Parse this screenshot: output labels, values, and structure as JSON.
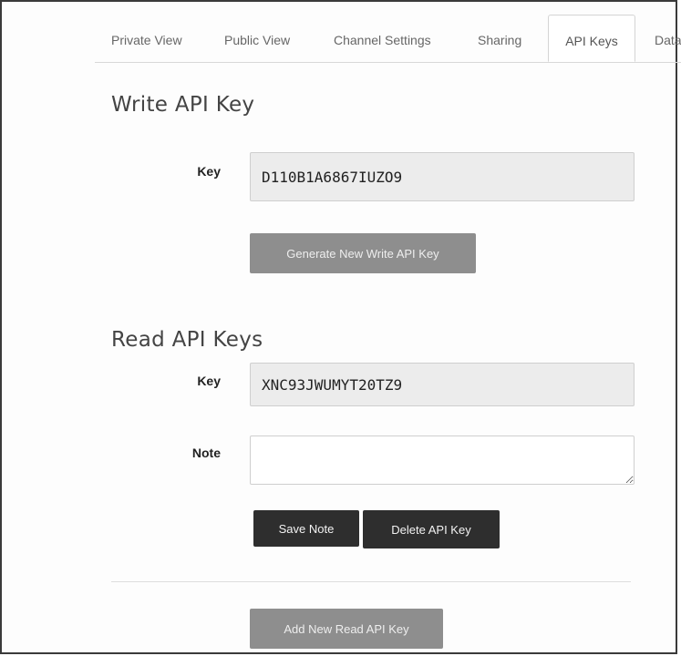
{
  "tabs": [
    {
      "label": "Private View",
      "active": false
    },
    {
      "label": "Public View",
      "active": false
    },
    {
      "label": "Channel Settings",
      "active": false
    },
    {
      "label": "Sharing",
      "active": false
    },
    {
      "label": "API Keys",
      "active": true
    },
    {
      "label": "Data",
      "active": false
    }
  ],
  "write": {
    "title": "Write API Key",
    "key_label": "Key",
    "key_value": "D110B1A6867IUZO9",
    "generate_button": "Generate New Write API Key"
  },
  "read": {
    "title": "Read API Keys",
    "key_label": "Key",
    "key_value": "XNC93JWUMYT20TZ9",
    "note_label": "Note",
    "note_value": "",
    "save_button": "Save Note",
    "delete_button": "Delete API Key",
    "add_button": "Add New Read API Key"
  },
  "colors": {
    "active_tab_border": "#d4d4d4",
    "key_field_bg": "#ececec",
    "button_gray": "#8e8e8e",
    "button_dark": "#2e2e2e"
  }
}
